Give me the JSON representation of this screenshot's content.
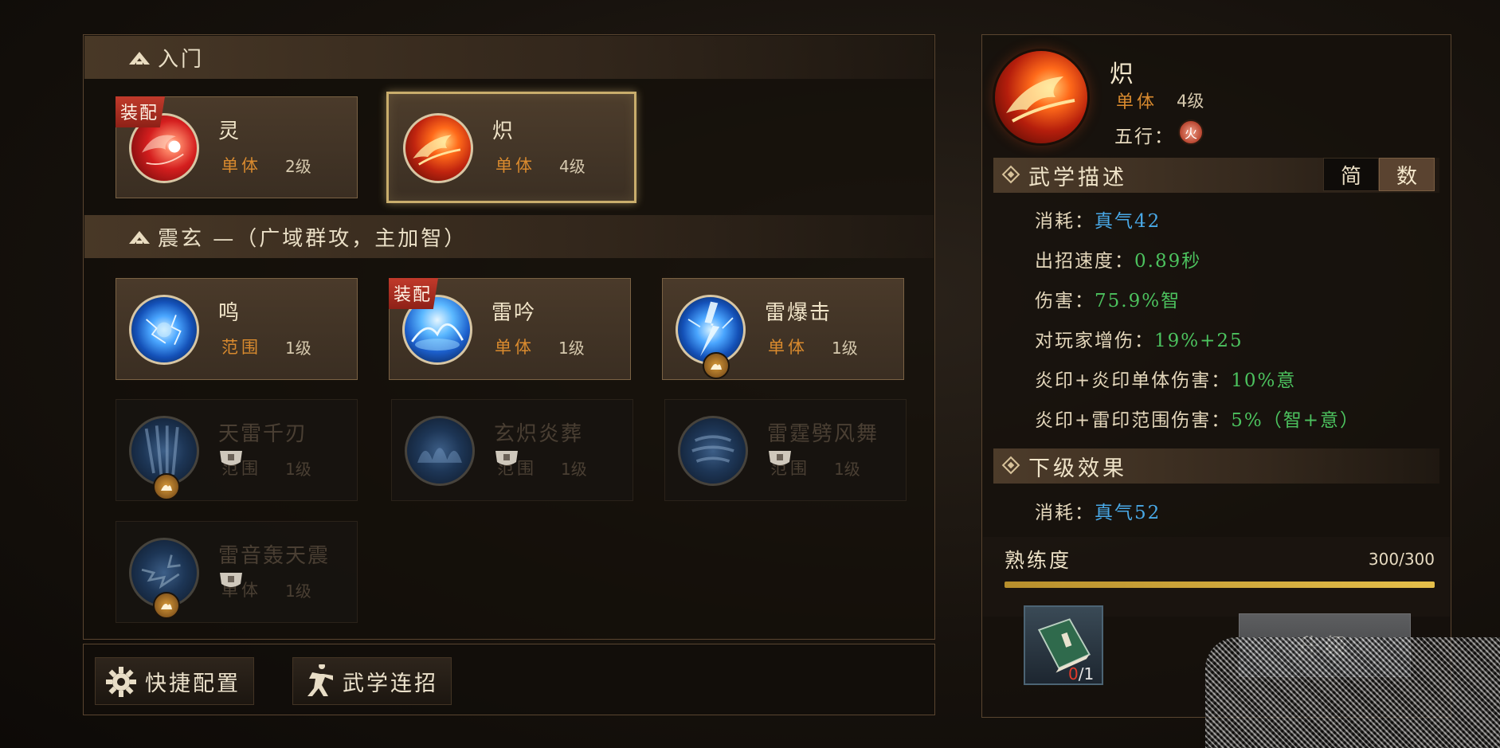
{
  "sections": [
    {
      "title": "入门"
    },
    {
      "title": "震玄 —（广域群攻，主加智）"
    }
  ],
  "skills_basic": [
    {
      "name": "灵",
      "type": "单体",
      "level": "2级",
      "badge": "装配"
    },
    {
      "name": "炽",
      "type": "单体",
      "level": "4级"
    }
  ],
  "skills_zhenxuan": [
    {
      "name": "鸣",
      "type": "范围",
      "level": "1级"
    },
    {
      "name": "雷吟",
      "type": "单体",
      "level": "1级",
      "badge": "装配"
    },
    {
      "name": "雷爆击",
      "type": "单体",
      "level": "1级"
    },
    {
      "name": "天雷千刃",
      "type": "范围",
      "level": "1级"
    },
    {
      "name": "玄炽炎葬",
      "type": "范围",
      "level": "1级"
    },
    {
      "name": "雷霆劈风舞",
      "type": "范围",
      "level": "1级"
    },
    {
      "name": "雷音轰天震",
      "type": "单体",
      "level": "1级"
    }
  ],
  "bottom": {
    "quick_config": "快捷配置",
    "combo": "武学连招"
  },
  "detail": {
    "name": "炽",
    "type": "单体",
    "level": "4级",
    "wuxing_label": "五行：",
    "wuxing_value": "火",
    "desc_title": "武学描述",
    "toggle_simple": "简",
    "toggle_num": "数",
    "stats": [
      {
        "label": "消耗：",
        "value": "真气42",
        "color": "blue"
      },
      {
        "label": "出招速度：",
        "value": "0.89秒",
        "color": "green"
      },
      {
        "label": "伤害：",
        "value": "75.9%智",
        "color": "green"
      },
      {
        "label": "对玩家增伤：",
        "value": "19%+25",
        "color": "green"
      },
      {
        "label": "炎印+炎印单体伤害：",
        "value": "10%意",
        "color": "green"
      },
      {
        "label": "炎印+雷印范围伤害：",
        "value": "5%（智+意）",
        "color": "green"
      }
    ],
    "next_title": "下级效果",
    "next_stats": [
      {
        "label": "消耗：",
        "value": "真气52",
        "color": "blue"
      }
    ],
    "proficiency_label": "熟练度",
    "proficiency_value": "300/300",
    "proficiency_fraction": 1.0,
    "book_have": "0",
    "book_need": "/1",
    "upgrade_label": "升级"
  },
  "colors": {
    "accent_orange": "#d98a2e",
    "value_blue": "#49a8e6",
    "value_green": "#4cc25e",
    "gold": "#c9ad6c"
  }
}
